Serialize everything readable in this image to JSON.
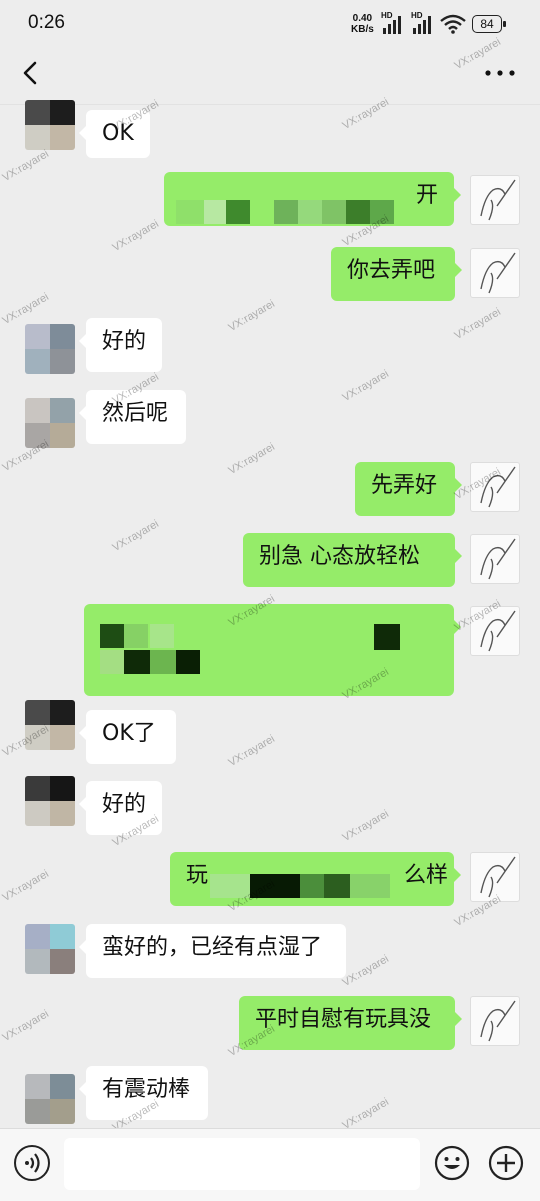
{
  "status_bar": {
    "time": "0:26",
    "net_speed_value": "0.40",
    "net_speed_unit": "KB/s",
    "hd1": "HD",
    "hd2": "HD",
    "battery": "84"
  },
  "header": {
    "back_icon": "chevron-left-icon",
    "more_icon": "more-dots-icon"
  },
  "watermark": "VX:rayarei",
  "colors": {
    "background": "#ededed",
    "incoming_bubble": "#ffffff",
    "outgoing_bubble": "#95ec69"
  },
  "messages": [
    {
      "side": "in",
      "text": "OK"
    },
    {
      "side": "out",
      "text": "开",
      "redacted": true
    },
    {
      "side": "out",
      "text": "你去弄吧"
    },
    {
      "side": "in",
      "text": "好的"
    },
    {
      "side": "in",
      "text": "然后呢"
    },
    {
      "side": "out",
      "text": "先弄好"
    },
    {
      "side": "out",
      "text": "别急 心态放轻松"
    },
    {
      "side": "out",
      "text": "",
      "redacted": true
    },
    {
      "side": "in",
      "text": "OK了"
    },
    {
      "side": "in",
      "text": "好的"
    },
    {
      "side": "out",
      "text": "么样",
      "prefix": "玩",
      "redacted": true
    },
    {
      "side": "in",
      "text": "蛮好的，已经有点湿了"
    },
    {
      "side": "out",
      "text": "平时自慰有玩具没"
    },
    {
      "side": "in",
      "text": "有震动棒"
    }
  ],
  "input_bar": {
    "voice_icon": "voice-icon",
    "emoji_icon": "emoji-icon",
    "plus_icon": "plus-icon",
    "text_value": ""
  }
}
